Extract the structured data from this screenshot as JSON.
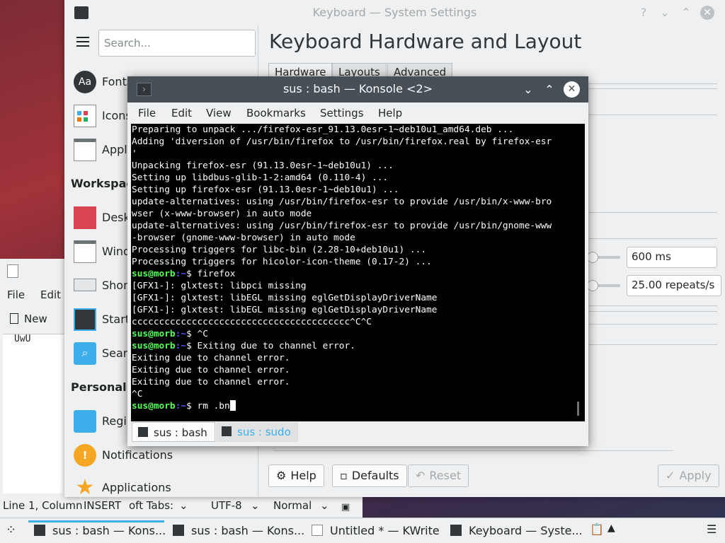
{
  "kwrite": {
    "menu": [
      "File",
      "Edit"
    ],
    "new_label": "New",
    "editor_text": "UwU",
    "status": {
      "position": "Line 1, Column",
      "mode": "INSERT",
      "tabs": "oft Tabs: ",
      "encoding": "UTF-8",
      "syntax": "Normal"
    }
  },
  "settings": {
    "title": "Keyboard — System Settings",
    "search_placeholder": "Search...",
    "sidebar": {
      "items_top": [
        "Fonts",
        "Icons",
        "Appl"
      ],
      "section_workspace": "Workspac",
      "items_workspace": [
        "Desk",
        "Wind",
        "Shor",
        "Start",
        "Sear"
      ],
      "section_personal": "Personali",
      "items_personal": [
        "Regi",
        "Notifications",
        "Applications"
      ]
    },
    "page_title": "Keyboard Hardware and Layout",
    "tabs": [
      "Hardware",
      "Layouts",
      "Advanced"
    ],
    "delay_value": "600 ms",
    "rate_value": "25.00 repeats/s",
    "buttons": {
      "help": "Help",
      "defaults": "Defaults",
      "reset": "Reset",
      "apply": "Apply"
    }
  },
  "konsole": {
    "title": "sus : bash — Konsole <2>",
    "menu": [
      "File",
      "Edit",
      "View",
      "Bookmarks",
      "Settings",
      "Help"
    ],
    "prompt_user": "sus@morb",
    "prompt_path": ":~",
    "prompt_symbol": "$",
    "lines": [
      "Preparing to unpack .../firefox-esr_91.13.0esr-1~deb10u1_amd64.deb ...",
      "Adding 'diversion of /usr/bin/firefox to /usr/bin/firefox.real by firefox-esr",
      "'",
      "Unpacking firefox-esr (91.13.0esr-1~deb10u1) ...",
      "Setting up libdbus-glib-1-2:amd64 (0.110-4) ...",
      "Setting up firefox-esr (91.13.0esr-1~deb10u1) ...",
      "update-alternatives: using /usr/bin/firefox-esr to provide /usr/bin/x-www-bro",
      "wser (x-www-browser) in auto mode",
      "update-alternatives: using /usr/bin/firefox-esr to provide /usr/bin/gnome-www",
      "-browser (gnome-www-browser) in auto mode",
      "Processing triggers for libc-bin (2.28-10+deb10u1) ...",
      "Processing triggers for hicolor-icon-theme (0.17-2) ..."
    ],
    "cmd1": " firefox",
    "out1": [
      "[GFX1-]: glxtest: libpci missing",
      "[GFX1-]: glxtest: libEGL missing eglGetDisplayDriverName",
      "[GFX1-]: glxtest: libEGL missing eglGetDisplayDriverName",
      "cccccccccccccccccccccccccccccccccccccccc^C^C"
    ],
    "cmd2": " ^C",
    "cmd3": " Exiting due to channel error.",
    "out3": [
      "Exiting due to channel error.",
      "Exiting due to channel error.",
      "Exiting due to channel error.",
      "^C"
    ],
    "cmd4": " rm .bn",
    "tabs": [
      "sus : bash",
      "sus : sudo"
    ]
  },
  "taskbar": {
    "tasks": [
      "sus : bash — Kons...",
      "sus : bash — Kons...",
      "Untitled * — KWrite",
      "Keyboard  — Syste..."
    ]
  }
}
